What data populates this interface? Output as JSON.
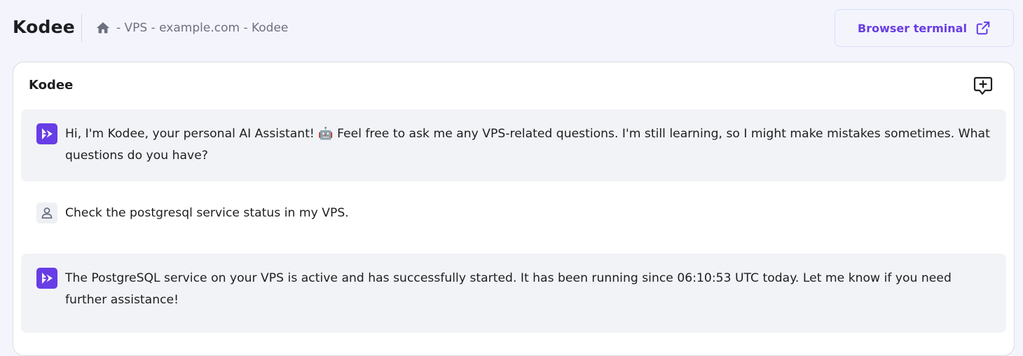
{
  "header": {
    "title": "Kodee",
    "breadcrumb": "- VPS - example.com - Kodee",
    "browser_terminal_label": "Browser terminal"
  },
  "chat": {
    "title": "Kodee",
    "messages": [
      {
        "role": "assistant",
        "text": "Hi, I'm Kodee, your personal AI Assistant! 🤖 Feel free to ask me any VPS-related questions. I'm still learning, so I might make mistakes sometimes. What questions do you have?"
      },
      {
        "role": "user",
        "text": "Check the postgresql service status in my VPS."
      },
      {
        "role": "assistant",
        "text": "The PostgreSQL service on your VPS is active and has successfully started. It has been running since 06:10:53 UTC today. Let me know if you need further assistance!"
      }
    ]
  },
  "icons": {
    "home": "home-icon",
    "external_link": "external-link-icon",
    "new_chat": "new-chat-icon",
    "kodee": "kodee-avatar-icon",
    "user": "user-avatar-icon"
  },
  "colors": {
    "accent": "#673de6",
    "page_background": "#f4f4fc",
    "assistant_message_bg": "#f2f3f6"
  }
}
